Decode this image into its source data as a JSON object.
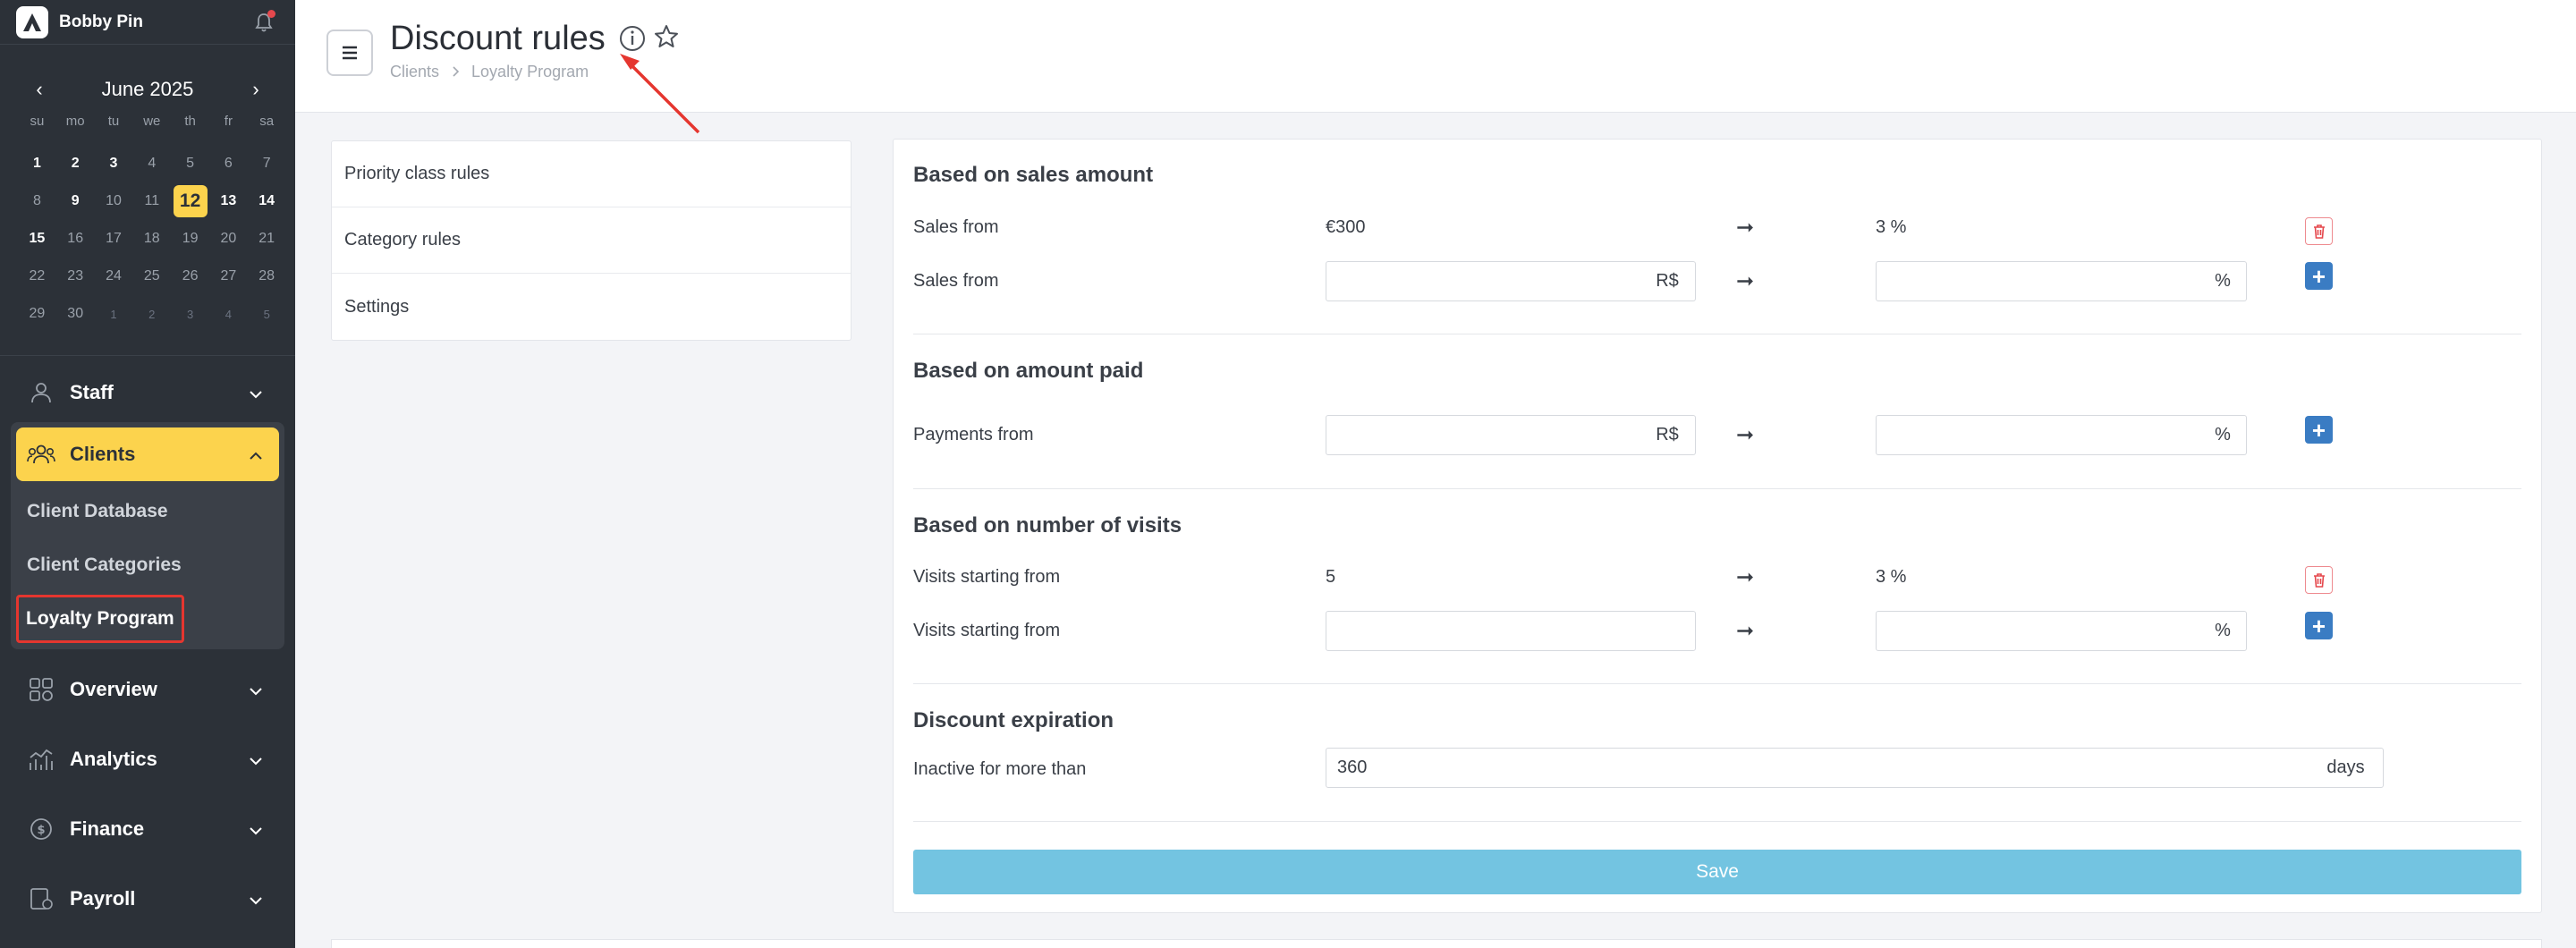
{
  "sidebar": {
    "user_name": "Bobby Pin",
    "calendar": {
      "month_label": "June 2025",
      "day_headers": [
        "su",
        "mo",
        "tu",
        "we",
        "th",
        "fr",
        "sa"
      ],
      "weeks": [
        [
          "1",
          "2",
          "3",
          "4",
          "5",
          "6",
          "7"
        ],
        [
          "8",
          "9",
          "10",
          "11",
          "12",
          "13",
          "14"
        ],
        [
          "15",
          "16",
          "17",
          "18",
          "19",
          "20",
          "21"
        ],
        [
          "22",
          "23",
          "24",
          "25",
          "26",
          "27",
          "28"
        ],
        [
          "29",
          "30",
          "1",
          "2",
          "3",
          "4",
          "5"
        ]
      ],
      "today": "12"
    },
    "nav": {
      "staff": "Staff",
      "clients": "Clients",
      "client_database": "Client Database",
      "client_categories": "Client Categories",
      "loyalty_program": "Loyalty Program",
      "overview": "Overview",
      "analytics": "Analytics",
      "finance": "Finance",
      "payroll": "Payroll"
    }
  },
  "header": {
    "title": "Discount rules",
    "breadcrumb": [
      "Clients",
      "Loyalty Program"
    ]
  },
  "left_panel": {
    "items": [
      "Priority class rules",
      "Category rules",
      "Settings"
    ]
  },
  "main": {
    "sales": {
      "title": "Based on sales amount",
      "row1_label": "Sales from",
      "row1_value": "€300",
      "row1_percent": "3 %",
      "row2_label": "Sales from",
      "currency": "R$",
      "percent_sign": "%"
    },
    "paid": {
      "title": "Based on amount paid",
      "row_label": "Payments from",
      "currency": "R$",
      "percent_sign": "%"
    },
    "visits": {
      "title": "Based on number of visits",
      "row1_label": "Visits starting from",
      "row1_value": "5",
      "row1_percent": "3 %",
      "row2_label": "Visits starting from",
      "percent_sign": "%"
    },
    "expiration": {
      "title": "Discount expiration",
      "label": "Inactive for more than",
      "value": "360",
      "unit": "days"
    },
    "arrow": "➞",
    "save_label": "Save"
  },
  "colors": {
    "sidebar_bg": "#2c3138",
    "accent_yellow": "#fcd34d",
    "add_button": "#3a7cc3",
    "save_button": "#73c4e1",
    "delete_border": "#ee8a8f",
    "annotation_red": "#e5362f"
  }
}
